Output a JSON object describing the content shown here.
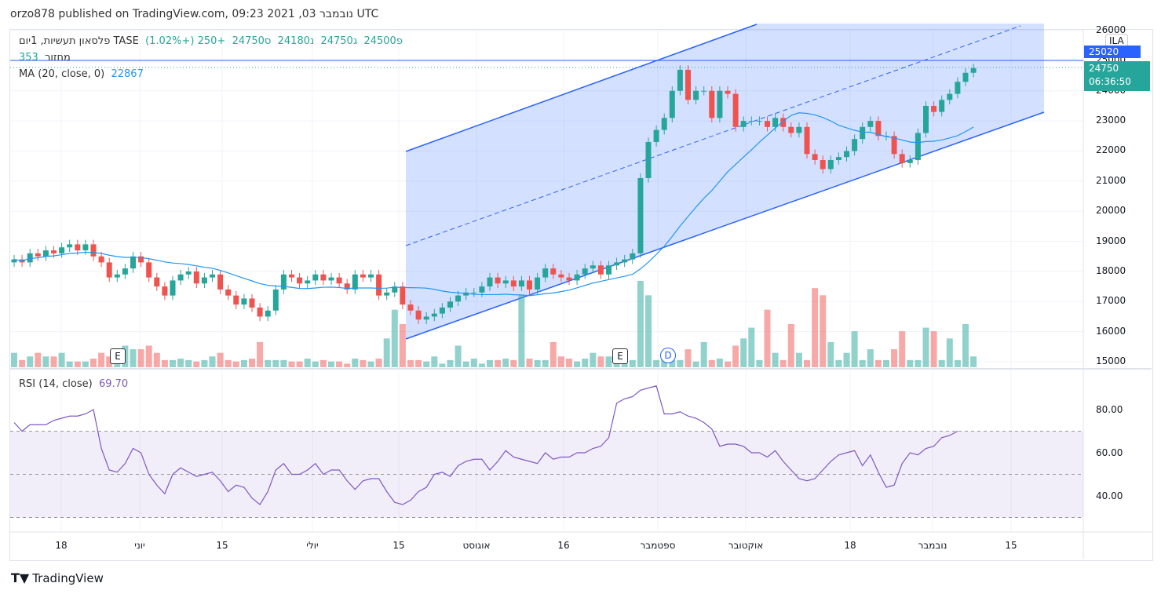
{
  "header": {
    "published": "orzo878 published on TradingView.com, 09:23 2021 ,03 נובמבר UTC"
  },
  "legend": {
    "symbol": "פלסאון תעשיות, 1יום  TASE",
    "open": "פ24500",
    "high": "ג24750",
    "low": "נ24180",
    "close": "ס24750",
    "change": "+250 (+1.02%)",
    "volume_label": "מחזור",
    "volume": "353",
    "ma_label": "MA (20, close, 0)",
    "ma_value": "22867",
    "rsi_label": "RSI (14, close)",
    "rsi_value": "69.70"
  },
  "price_scale": {
    "ticks": [
      26000,
      25000,
      24000,
      23000,
      22000,
      21000,
      20000,
      19000,
      18000,
      17000,
      16000,
      15000
    ],
    "currency_tag": "ILA",
    "alert_price": "25020",
    "last_price": "24750",
    "countdown": "06:36:50"
  },
  "rsi_scale": {
    "ticks": [
      "80.00",
      "60.00",
      "40.00"
    ]
  },
  "time_axis": [
    "18",
    "יוני",
    "15",
    "יולי",
    "15",
    "אוגוסט",
    "16",
    "ספטמבר",
    "אוקטובר",
    "18",
    "נובמבר",
    "15"
  ],
  "markers": {
    "earnings": "E",
    "dividend": "D"
  },
  "brand": "TradingView",
  "colors": {
    "up": "#26a69a",
    "down": "#ef5350",
    "ma": "#2196f3",
    "rsi": "#7e57c2",
    "channel": "#2962ff"
  },
  "chart_data": {
    "type": "candlestick",
    "closes": [
      18400,
      18300,
      18600,
      18500,
      18700,
      18600,
      18800,
      18900,
      18700,
      18900,
      18500,
      18300,
      17800,
      17900,
      18100,
      18500,
      18300,
      17800,
      17500,
      17200,
      17700,
      17900,
      18000,
      17600,
      17800,
      17900,
      17400,
      17200,
      16900,
      17100,
      16800,
      16500,
      16700,
      17400,
      17900,
      17800,
      17600,
      17700,
      17900,
      17700,
      17800,
      17600,
      17400,
      17900,
      17800,
      17900,
      17200,
      17300,
      17500,
      16900,
      16700,
      16400,
      16500,
      16600,
      16800,
      17000,
      17200,
      17300,
      17300,
      17500,
      17800,
      17600,
      17700,
      17500,
      17700,
      17400,
      17800,
      18100,
      17900,
      17800,
      17700,
      17900,
      18100,
      18200,
      17900,
      18200,
      18300,
      18400,
      18600,
      21100,
      22300,
      22700,
      23100,
      24000,
      24700,
      23700,
      24000,
      24000,
      23100,
      24000,
      23900,
      22800,
      23000,
      23000,
      23000,
      22800,
      23100,
      22800,
      22600,
      22800,
      21900,
      21700,
      21400,
      21700,
      21800,
      22000,
      22400,
      22800,
      23000,
      22500,
      22500,
      21900,
      21600,
      21700,
      22600,
      23500,
      23300,
      23700,
      23900,
      24300,
      24600,
      24750
    ],
    "volumes": [
      20,
      10,
      15,
      20,
      15,
      15,
      20,
      8,
      8,
      8,
      12,
      20,
      15,
      15,
      30,
      25,
      25,
      30,
      20,
      10,
      10,
      12,
      10,
      8,
      10,
      15,
      20,
      10,
      8,
      10,
      12,
      35,
      10,
      10,
      10,
      8,
      8,
      12,
      8,
      10,
      8,
      8,
      5,
      12,
      10,
      8,
      12,
      40,
      80,
      60,
      10,
      10,
      8,
      15,
      5,
      10,
      30,
      8,
      12,
      5,
      10,
      10,
      12,
      10,
      100,
      12,
      10,
      10,
      35,
      15,
      12,
      8,
      12,
      20,
      15,
      15,
      12,
      8,
      10,
      120,
      100,
      10,
      20,
      10,
      10,
      25,
      8,
      35,
      10,
      12,
      8,
      30,
      40,
      55,
      10,
      80,
      20,
      10,
      60,
      20,
      10,
      110,
      100,
      35,
      10,
      20,
      50,
      10,
      25,
      10,
      10,
      25,
      50,
      10,
      10,
      55,
      50,
      10,
      40,
      10,
      60,
      15,
      10
    ],
    "rsi": [
      74,
      70,
      73,
      73,
      73,
      75,
      76,
      77,
      77,
      78,
      80,
      62,
      52,
      51,
      55,
      62,
      60,
      50,
      45,
      41,
      50,
      53,
      51,
      49,
      50,
      51,
      47,
      42,
      45,
      44,
      39,
      36,
      42,
      52,
      55,
      50,
      50,
      52,
      55,
      50,
      52,
      52,
      47,
      43,
      47,
      48,
      48,
      42,
      37,
      36,
      38,
      42,
      44,
      50,
      51,
      49,
      54,
      56,
      57,
      57,
      52,
      56,
      61,
      58,
      57,
      56,
      55,
      60,
      57,
      58,
      58,
      60,
      60,
      62,
      63,
      67,
      83,
      85,
      86,
      89,
      90,
      91,
      78,
      78,
      79,
      77,
      76,
      74,
      71,
      63,
      64,
      64,
      63,
      60,
      60,
      58,
      61,
      56,
      52,
      48,
      47,
      48,
      52,
      56,
      59,
      60,
      61,
      54,
      59,
      51,
      44,
      45,
      55,
      60,
      59,
      62,
      63,
      67,
      68,
      70
    ],
    "rsi_levels": [
      70,
      50,
      30
    ],
    "ylim": [
      15000,
      26000
    ],
    "rsi_ylim": [
      30,
      90
    ]
  }
}
